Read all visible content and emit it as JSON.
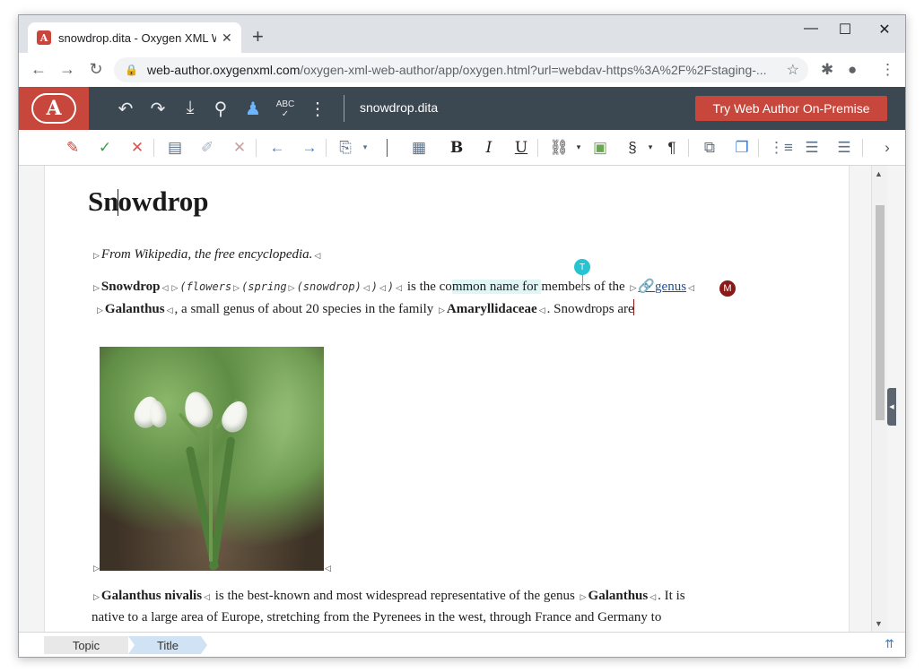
{
  "browser": {
    "tab_title": "snowdrop.dita - Oxygen XML We",
    "tab_favicon": "A",
    "url_host": "web-author.oxygenxml.com",
    "url_path": "/oxygen-xml-web-author/app/oxygen.html?url=webdav-https%3A%2F%2Fstaging-..."
  },
  "app": {
    "file_name": "snowdrop.dita",
    "try_button": "Try Web Author On-Premise",
    "spell_icon_text": "ABC"
  },
  "doc": {
    "title_a": "Sn",
    "title_b": "owdrop",
    "source_note": "From Wikipedia, the free encyclopedia.",
    "p1": {
      "term": "Snowdrop",
      "flowers": "(flowers",
      "spring": "(spring",
      "snowdrop": "(snowdrop)",
      "close1": ")",
      "close2": ")",
      "text1": " is the co",
      "highlight": "mmon name for ",
      "text2": "members of the ",
      "link": "genus",
      "line2_term": "Galanthus",
      "line2_text1": ", a small genus of about 20 species in the family ",
      "line2_family": "Amaryllidaceae",
      "line2_text2": ". Snowdrops are"
    },
    "ann_t": "T",
    "ann_m": "M",
    "p2": {
      "term": "Galanthus nivalis",
      "text1": " is the best-known and most widespread representative of the genus ",
      "genus": "Galanthus",
      "text2": ". It is",
      "line2": "native to a large area of Europe, stretching from the Pyrenees in the west, through France and Germany to"
    }
  },
  "breadcrumb": [
    "Topic",
    "Title"
  ],
  "colors": {
    "appbar": "#3b4751",
    "accent": "#c8473d",
    "comment_t": "#27c3d0",
    "comment_m": "#8a1a1a"
  }
}
